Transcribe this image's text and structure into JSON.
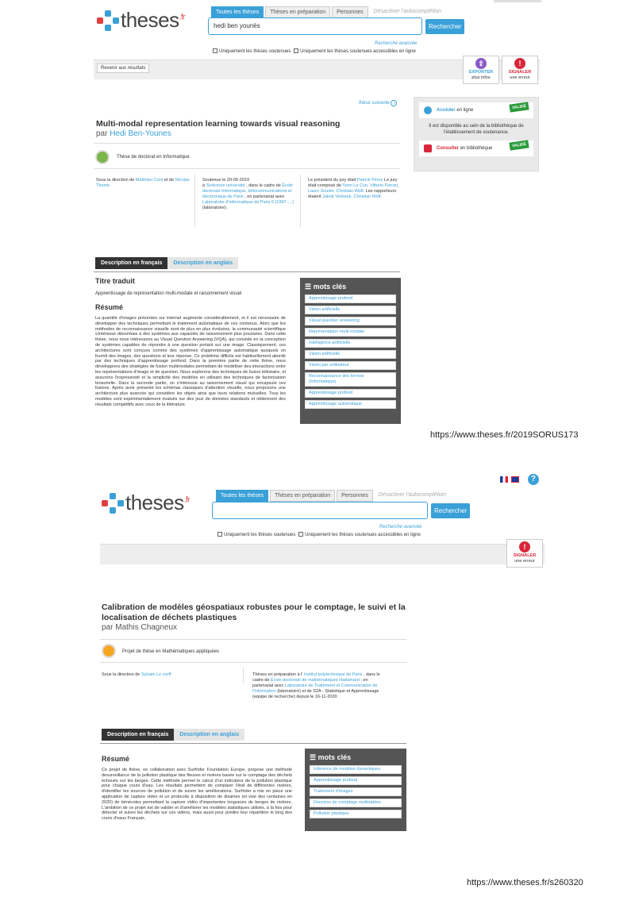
{
  "colors": {
    "accent": "#3aa0d8",
    "export": "#8a5ac6",
    "signal": "#d9263a",
    "valide": "#2a9a3a",
    "keywords_bg": "#555555"
  },
  "common": {
    "logo": "theses",
    "logo_suffix": ".fr",
    "tabs": [
      "Toutes les thèses",
      "Thèses en préparation",
      "Personnes"
    ],
    "autocomplete": "Désactiver l'autocomplétion",
    "search_btn": "Rechercher",
    "advanced": "Recherche avancée",
    "cb1": "Uniquement les thèses soutenues",
    "cb2": "Uniquement les thèses soutenues accessibles en ligne",
    "signal_label": "SIGNALER",
    "signal_sub": "une erreur",
    "export_label": "EXPORTER",
    "export_sub": "plus infos",
    "desc_fr": "Description en français",
    "desc_en": "Description en anglais",
    "keywords_title": "mots clés",
    "resume_h": "Résumé"
  },
  "page1": {
    "search_value": "hedi ben  younès",
    "back": "Revenir aux résultats",
    "next": "thèse suivante",
    "title": "Multi-modal representation learning towards visual reasoning",
    "author_prefix": "par",
    "author": "Hedi Ben-Younes",
    "type": "Thèse de doctorat en Informatique",
    "col1_a": "Sous la direction de",
    "col1_link1": "Matthieu Cord",
    "col1_b": "et de",
    "col1_link2": "Nicolas Thome",
    "col2_a": "Soutenue le 20-05-2019",
    "col2_b": "à",
    "col2_link1": "Sorbonne université",
    "col2_c": ", dans le cadre de",
    "col2_link2": "École doctorale Informatique, télécommunications et électronique de Paris",
    "col2_d": ", en partenariat avec",
    "col2_link3": "Laboratoire d'informatique de Paris 6 (1997-....)",
    "col2_e": "(laboratoire) .",
    "col3_a": "Le président du jury était",
    "col3_link1": "Patrick Pérez",
    "col3_b": "Le jury était composé de",
    "col3_link2": "Yann Le Cun, Vittorio Ferrari, Laure Soulier, Christian Wolf.",
    "col3_c": "Les rapporteurs étaient",
    "col3_link3": "Jakob Verbeek, Christian Wolf.",
    "acceder": "Accéder",
    "acceder_rest": "en ligne",
    "dispo": "Il est disponible au sein de la bibliothèque de l'établissement de soutenance.",
    "consulter": "Consulter",
    "consulter_rest": "en bibliothèque",
    "valide": "VALIDÉ",
    "titre_traduit_h": "Titre traduit",
    "titre_traduit": "Apprentissage de représentation multi-modale et raisonnement visuel",
    "resume": "La quantité d'images présentes sur internet augmente considérablement, et il est nécessaire de développer des techniques permettant le traitement automatique de ces contenus. Alors que les méthodes de reconnaissance visuelle sont de plus en plus évoluées, la communauté scientifique s'intéresse désormais à des systèmes aux capacités de raisonnement plus poussées. Dans cette thèse, nous nous intéressons au Visual Question Answering (VQA), qui consiste en la conception de systèmes capables de répondre à une question portant sur une image. Classiquement, ces architectures sont conçues comme des systèmes d'apprentissage automatique auxquels on fournit des images, des questions et leur réponse. Ce problème difficile est habituellement abordé par des techniques d'apprentissage profond. Dans la première partie de cette thèse, nous développons des stratégies de fusion multimodales permettant de modéliser des interactions entre les représentations d'image et de question. Nous explorons des techniques de fusion bilinéaire, et assurons l'expressivité et la simplicité des modèles en utilisant des techniques de factorisation tensorielle. Dans la seconde partie, on s'intéresse au raisonnement visuel qui encapsule ces fusions. Après avoir présenté les schémas classiques d'attention visuelle, nous proposons une architecture plus avancée qui considère les objets ainsi que leurs relations mutuelles. Tous les modèles sont expérimentalement évalués sur des jeux de données standards et obtiennent des résultats compétitifs avec ceux de la littérature.",
    "keywords": [
      "Apprentissage profond",
      "Vision artificielle",
      "Visual question answering",
      "Représentation multi-modale",
      "Intelligence artificielle",
      "Vision artificielle",
      "Vision par ordinateur",
      "Reconnaissance des formes (Informatique)",
      "Apprentissage profond",
      "Apprentissage automatique"
    ],
    "url": "https://www.theses.fr/2019SORUS173"
  },
  "page2": {
    "search_value": "",
    "title": "Calibration de modèles géospatiaux robustes pour le comptage, le suivi et la localisation de déchets plastiques",
    "author_prefix": "par",
    "author": "Mathis Chagneux",
    "type": "Projet de thèse en Mathématiques appliquées",
    "col1_a": "Sous la direction de",
    "col1_link1": "Sylvain Le corff",
    "col2_a": "Thèses en préparation à l'",
    "col2_link1": "Institut polytechnique de Paris",
    "col2_b": ", dans le cadre de",
    "col2_link2": "École doctorale de mathématiques Hadamard",
    "col2_c": ", en partenariat avec",
    "col2_link3": "Laboratoire de Traitement et Communication de l'Information",
    "col2_d": "(laboratoire) et de S2A - Statistique et Apprentissage (equipe de recherche) depuis le 16-11-2020 .",
    "resume": "Ce projet de thèse, en collaboration avec Surfrider Foundation Europe, propose une méthode desurveillance de la pollution plastique des fleuves et rivières basée sur le comptage des déchets échoués sur les berges. Cette méthode permet le calcul d'un indicateur de la pollution plastique pour chaque cours d'eau. Les résultats permettent de comparer l'état de différentes rivières, d'identifier les sources de pollution et de suivre les améliorations. Surfrider a mis en place une application de capture vidéo et un protocole à disposition de dizaines (et vise des centaines en 2020) de bénévoles permettant la capture vidéo d'importantes longueurs de berges de rivières. L'ambition de ce projet est de valider et d'améliorer les modèles statistiques utilisés, à la fois pour détecter et suivre les déchets sur ces vidéos, mais aussi pour prédire leur répartition le long des cours d'eaux Français.",
    "keywords": [
      "Inférence de modèles dynamiques",
      "Apprentissage profond",
      "Traitement d'images",
      "Données de comptage multinatées",
      "Pollution plastique"
    ],
    "url": "https://www.theses.fr/s260320"
  }
}
